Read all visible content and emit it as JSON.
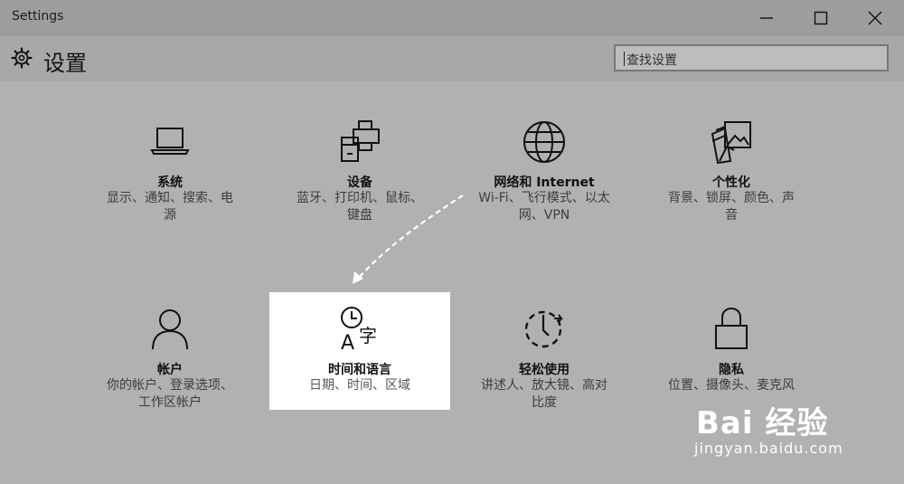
{
  "window": {
    "title": "Settings",
    "controls": {
      "minimize": "minimize-icon",
      "maximize": "maximize-icon",
      "close": "close-icon"
    }
  },
  "header": {
    "icon": "gear-icon",
    "title": "设置",
    "search_placeholder": "查找设置"
  },
  "selected_tile": "时间和语言",
  "tiles": [
    {
      "icon": "laptop-icon",
      "label": "系统",
      "desc1": "显示、通知、搜索、电",
      "desc2": "源"
    },
    {
      "icon": "devices-icon",
      "label": "设备",
      "desc1": "蓝牙、打印机、鼠标、",
      "desc2": "键盘"
    },
    {
      "icon": "globe-icon",
      "label": "网络和 Internet",
      "desc1": "Wi-Fi、飞行模式、以太",
      "desc2": "网、VPN"
    },
    {
      "icon": "personalization-icon",
      "label": "个性化",
      "desc1": "背景、锁屏、颜色、声",
      "desc2": "音"
    },
    {
      "icon": "person-icon",
      "label": "帐户",
      "desc1": "你的帐户、登录选项、",
      "desc2": "工作区帐户"
    },
    {
      "icon": "time-language-icon",
      "label": "时间和语言",
      "desc1": "日期、时间、区域",
      "desc2": ""
    },
    {
      "icon": "ease-of-access-icon",
      "label": "轻松使用",
      "desc1": "讲述人、放大镜、高对",
      "desc2": "比度"
    },
    {
      "icon": "lock-icon",
      "label": "隐私",
      "desc1": "位置、摄像头、麦克风",
      "desc2": ""
    }
  ],
  "watermark": {
    "brand": "Bai 经验",
    "url": "jingyan.baidu.com"
  },
  "colors": {
    "titlebar": "#9d9d9d",
    "header": "#a8a8a8",
    "content": "#b1b1b1",
    "selected": "#ffffff"
  }
}
